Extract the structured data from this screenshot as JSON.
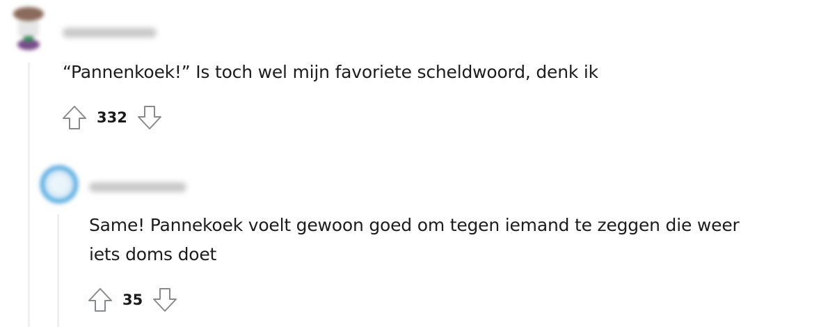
{
  "comments": [
    {
      "avatar_name": "user-avatar-icon",
      "username_blurred": true,
      "text": "“Pannenkoek!” Is toch wel mijn favoriete scheldwoord, denk ik",
      "votes": "332",
      "upvote_icon": "upvote-arrow-icon",
      "downvote_icon": "downvote-arrow-icon"
    },
    {
      "avatar_name": "user-avatar-icon",
      "username_blurred": true,
      "text_line1": "Same! Pannekoek voelt gewoon goed om tegen iemand te zeggen die weer",
      "text_line2": "iets doms doet",
      "votes": "35",
      "upvote_icon": "upvote-arrow-icon",
      "downvote_icon": "downvote-arrow-icon"
    }
  ],
  "colors": {
    "thread_line": "#edeff1",
    "text": "#1c1c1c",
    "icon_stroke": "#878a8c"
  }
}
